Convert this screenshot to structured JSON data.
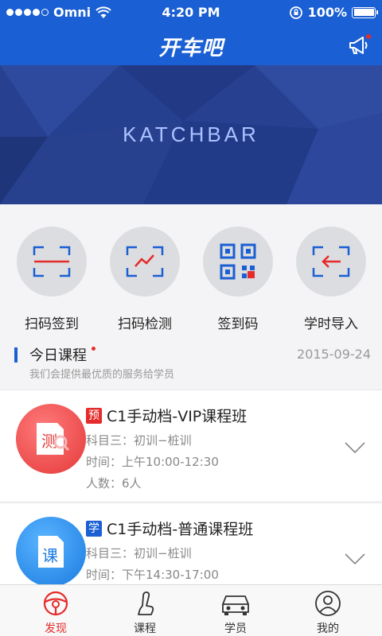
{
  "status_bar": {
    "carrier": "Omni",
    "time": "4:20 PM",
    "battery": "100%"
  },
  "nav": {
    "title": "开车吧",
    "action_icon": "megaphone-icon"
  },
  "banner": {
    "brand": "KATCHBAR"
  },
  "quick_actions": [
    {
      "label": "扫码签到",
      "icon": "scan-sign-in-icon"
    },
    {
      "label": "扫码检测",
      "icon": "scan-check-icon"
    },
    {
      "label": "签到码",
      "icon": "qr-code-icon"
    },
    {
      "label": "学时导入",
      "icon": "import-hours-icon"
    }
  ],
  "today": {
    "title": "今日课程",
    "subtitle": "我们会提供最优质的服务给学员",
    "date": "2015-09-24"
  },
  "courses": [
    {
      "tag": "预",
      "tag_color": "#e52b2b",
      "name": "C1手动档-VIP课程班",
      "avatar_text": "测",
      "subject": "科目三：初训−桩训",
      "time": "时间：上午10:00-12:30",
      "count": "人数：6人"
    },
    {
      "tag": "学",
      "tag_color": "#1a5fd3",
      "name": "C1手动档-普通课程班",
      "avatar_text": "课",
      "subject": "科目三：初训−桩训",
      "time": "时间：下午14:30-17:00"
    }
  ],
  "tabs": [
    {
      "label": "发现",
      "icon": "steering-wheel-icon",
      "active": true
    },
    {
      "label": "课程",
      "icon": "seat-icon",
      "active": false
    },
    {
      "label": "学员",
      "icon": "car-icon",
      "active": false
    },
    {
      "label": "我的",
      "icon": "user-icon",
      "active": false
    }
  ],
  "colors": {
    "primary": "#1a5fd3",
    "accent": "#e52b2b"
  }
}
